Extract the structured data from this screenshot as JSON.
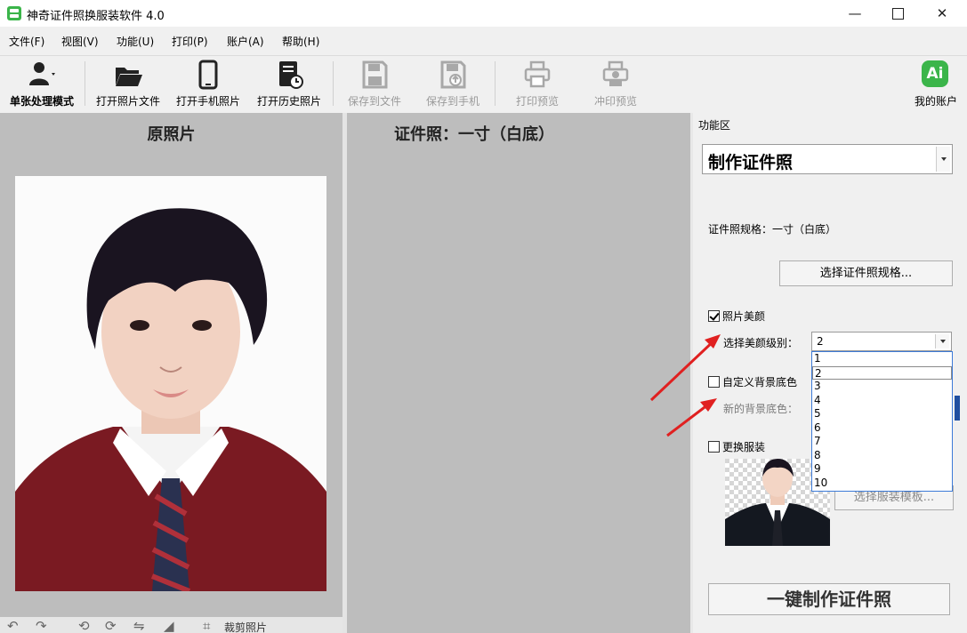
{
  "titlebar": {
    "title": "神奇证件照换服装软件 4.0",
    "minimize": "—",
    "close": "✕"
  },
  "menu": [
    "文件(F)",
    "视图(V)",
    "功能(U)",
    "打印(P)",
    "账户(A)",
    "帮助(H)"
  ],
  "toolbar": {
    "single_mode": "单张处理模式",
    "open_file": "打开照片文件",
    "open_phone": "打开手机照片",
    "open_history": "打开历史照片",
    "save_file": "保存到文件",
    "save_phone": "保存到手机",
    "print_preview": "打印预览",
    "develop_preview": "冲印预览",
    "account_badge": "Ai",
    "account": "我的账户"
  },
  "left_panel": {
    "title": "原照片",
    "crop_label": "裁剪照片"
  },
  "mid_panel": {
    "title": "证件照：一寸（白底）"
  },
  "right_panel": {
    "title": "功能区",
    "mode_select": "制作证件照",
    "spec_text": "证件照规格：一寸（白底）",
    "choose_spec_button": "选择证件照规格...",
    "beauty_checkbox": "照片美颜",
    "beauty_checked": true,
    "beauty_level_label": "选择美颜级别：",
    "beauty_level_value": "2",
    "beauty_level_options": [
      "1",
      "2",
      "3",
      "4",
      "5",
      "6",
      "7",
      "8",
      "9",
      "10"
    ],
    "custom_bg_checkbox": "自定义背景底色",
    "custom_bg_checked": false,
    "new_bg_label": "新的背景底色：",
    "new_bg_color": "#1f4fa0",
    "clothes_checkbox": "更换服装",
    "clothes_checked": false,
    "choose_clothes_button": "选择服装模板...",
    "make_button": "一键制作证件照"
  },
  "colors": {
    "accent_green": "#3bb54a",
    "panel_grey": "#bdbdbd",
    "annotation_red": "#e02020",
    "dropdown_border": "#3d7bd8"
  }
}
